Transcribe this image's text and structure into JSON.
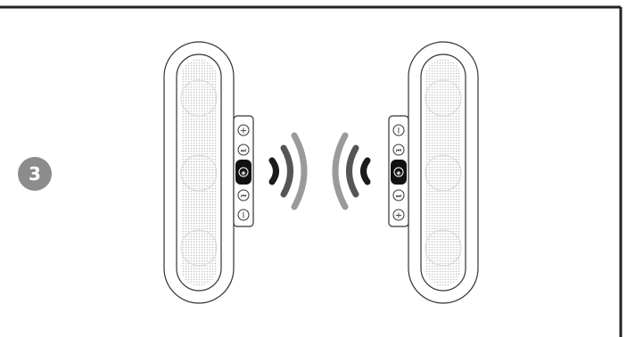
{
  "step": {
    "number": "3"
  },
  "speakers": [
    {
      "side": "left",
      "buttons": [
        "+",
        "⏭",
        "◈",
        "⏮",
        "I"
      ]
    },
    {
      "side": "right",
      "buttons": [
        "I",
        "⏮",
        "◈",
        "⏭",
        "+"
      ]
    }
  ],
  "colors": {
    "frame": "#222222",
    "badge": "#8c8c8c",
    "wave_dark": "#1a1a1a",
    "wave_mid": "#555555",
    "wave_light": "#9a9a9a",
    "grille": "#bdbdbd"
  },
  "icons": {
    "plus": "plus-icon",
    "next": "next-track-icon",
    "pair": "pairing-icon",
    "prev": "previous-track-icon",
    "power": "power-icon",
    "signal": "signal-wave-icon"
  }
}
